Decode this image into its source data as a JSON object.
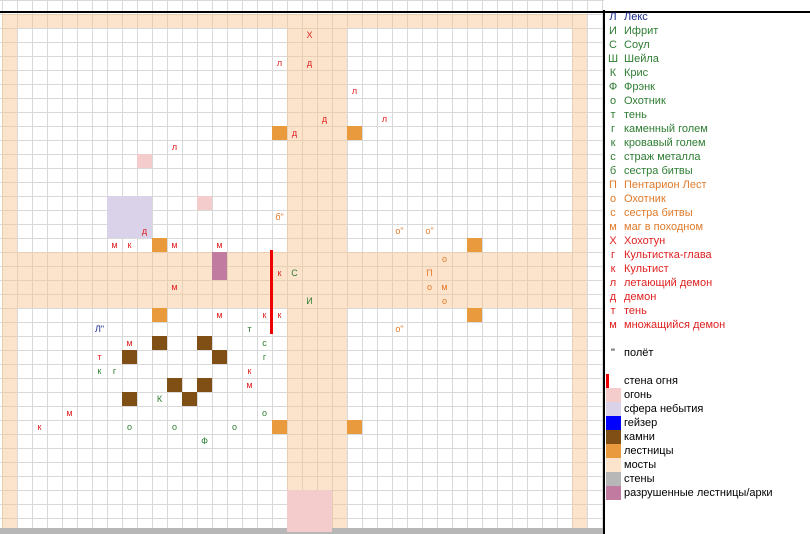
{
  "colors": {
    "bridge": "#fce4cc",
    "stairs": "#e89a3c",
    "fire": "#f4cccc",
    "void": "#d9d2e9",
    "geyser": "#0000ff",
    "rock": "#7f4f15",
    "wall": "#b7b7b7",
    "ruined": "#c27ba0",
    "firewall": "#ee0000",
    "blue": "#1a2a8a",
    "green": "#2e7d32",
    "orange": "#e07a2a",
    "red": "#e02020"
  },
  "legend": [
    {
      "sym": "Л",
      "text": "Лекс",
      "color": "blue",
      "kind": "ally"
    },
    {
      "sym": "И",
      "text": "Ифрит",
      "color": "green",
      "kind": "ally"
    },
    {
      "sym": "С",
      "text": "Соул",
      "color": "green",
      "kind": "ally"
    },
    {
      "sym": "Ш",
      "text": "Шейла",
      "color": "green",
      "kind": "ally"
    },
    {
      "sym": "К",
      "text": "Крис",
      "color": "green",
      "kind": "ally"
    },
    {
      "sym": "Ф",
      "text": "Фрэнк",
      "color": "green",
      "kind": "ally"
    },
    {
      "sym": "о",
      "text": "Охотник",
      "color": "green",
      "kind": "ally"
    },
    {
      "sym": "т",
      "text": "тень",
      "color": "green",
      "kind": "ally"
    },
    {
      "sym": "г",
      "text": "каменный голем",
      "color": "green",
      "kind": "ally"
    },
    {
      "sym": "к",
      "text": "кровавый голем",
      "color": "green",
      "kind": "ally"
    },
    {
      "sym": "с",
      "text": "страж металла",
      "color": "green",
      "kind": "ally"
    },
    {
      "sym": "б",
      "text": "сестра битвы",
      "color": "green",
      "kind": "ally"
    },
    {
      "sym": "П",
      "text": "Пентарион Лест",
      "color": "orange",
      "kind": "neutral"
    },
    {
      "sym": "о",
      "text": "Охотник",
      "color": "orange",
      "kind": "neutral"
    },
    {
      "sym": "с",
      "text": "сестра битвы",
      "color": "orange",
      "kind": "neutral"
    },
    {
      "sym": "м",
      "text": "маг в походном",
      "color": "orange",
      "kind": "neutral"
    },
    {
      "sym": "Х",
      "text": "Хохотун",
      "color": "red",
      "kind": "enemy"
    },
    {
      "sym": "г",
      "text": "Культистка-глава",
      "color": "red",
      "kind": "enemy"
    },
    {
      "sym": "к",
      "text": "Культист",
      "color": "red",
      "kind": "enemy"
    },
    {
      "sym": "л",
      "text": "летающий демон",
      "color": "red",
      "kind": "enemy"
    },
    {
      "sym": "д",
      "text": "демон",
      "color": "red",
      "kind": "enemy"
    },
    {
      "sym": "т",
      "text": "тень",
      "color": "red",
      "kind": "enemy"
    },
    {
      "sym": "м",
      "text": "множащийся демон",
      "color": "red",
      "kind": "enemy"
    },
    {
      "sym": "",
      "text": "",
      "kind": "gap"
    },
    {
      "sym": "\"",
      "text": "полёт",
      "color": "black",
      "kind": "note"
    },
    {
      "sym": "",
      "text": "",
      "kind": "gap"
    },
    {
      "sym": "",
      "text": "стена огня",
      "swatch": "firewall",
      "kind": "terrain"
    },
    {
      "sym": "",
      "text": "огонь",
      "swatch": "fire",
      "kind": "terrain"
    },
    {
      "sym": "",
      "text": "сфера небытия",
      "swatch": "void",
      "kind": "terrain"
    },
    {
      "sym": "",
      "text": "гейзер",
      "swatch": "geyser",
      "kind": "terrain"
    },
    {
      "sym": "",
      "text": "камни",
      "swatch": "rock",
      "kind": "terrain"
    },
    {
      "sym": "",
      "text": "лестницы",
      "swatch": "stairs",
      "kind": "terrain"
    },
    {
      "sym": "",
      "text": "мосты",
      "swatch": "bridge",
      "kind": "terrain"
    },
    {
      "sym": "",
      "text": "стены",
      "swatch": "wall",
      "kind": "terrain"
    },
    {
      "sym": "",
      "text": "разрушенные лестницы/арки",
      "swatch": "ruined",
      "kind": "terrain"
    }
  ],
  "terrain": [
    {
      "t": "stairs",
      "c": 18,
      "r": 9
    },
    {
      "t": "stairs",
      "c": 23,
      "r": 9
    },
    {
      "t": "stairs",
      "c": 10,
      "r": 17
    },
    {
      "t": "stairs",
      "c": 31,
      "r": 17
    },
    {
      "t": "stairs",
      "c": 10,
      "r": 22
    },
    {
      "t": "stairs",
      "c": 31,
      "r": 22
    },
    {
      "t": "stairs",
      "c": 18,
      "r": 30
    },
    {
      "t": "stairs",
      "c": 23,
      "r": 30
    },
    {
      "t": "fire",
      "c": 9,
      "r": 11
    },
    {
      "t": "fire",
      "c": 13,
      "r": 14
    },
    {
      "t": "void",
      "c": 7,
      "r": 14
    },
    {
      "t": "void",
      "c": 8,
      "r": 14
    },
    {
      "t": "void",
      "c": 9,
      "r": 14
    },
    {
      "t": "void",
      "c": 7,
      "r": 15
    },
    {
      "t": "void",
      "c": 8,
      "r": 15
    },
    {
      "t": "void",
      "c": 9,
      "r": 15
    },
    {
      "t": "void",
      "c": 7,
      "r": 16
    },
    {
      "t": "void",
      "c": 8,
      "r": 16
    },
    {
      "t": "void",
      "c": 9,
      "r": 16
    },
    {
      "t": "ruined",
      "c": 14,
      "r": 18
    },
    {
      "t": "ruined",
      "c": 14,
      "r": 19
    },
    {
      "t": "rock",
      "c": 10,
      "r": 24
    },
    {
      "t": "rock",
      "c": 13,
      "r": 24
    },
    {
      "t": "rock",
      "c": 8,
      "r": 25
    },
    {
      "t": "rock",
      "c": 14,
      "r": 25
    },
    {
      "t": "rock",
      "c": 11,
      "r": 27
    },
    {
      "t": "rock",
      "c": 13,
      "r": 27
    },
    {
      "t": "rock",
      "c": 8,
      "r": 28
    },
    {
      "t": "rock",
      "c": 12,
      "r": 28
    },
    {
      "t": "fire",
      "c": 19,
      "r": 35
    },
    {
      "t": "fire",
      "c": 20,
      "r": 35
    },
    {
      "t": "fire",
      "c": 21,
      "r": 35
    },
    {
      "t": "fire",
      "c": 19,
      "r": 36
    },
    {
      "t": "fire",
      "c": 20,
      "r": 36
    },
    {
      "t": "fire",
      "c": 21,
      "r": 36
    },
    {
      "t": "fire",
      "c": 19,
      "r": 37
    },
    {
      "t": "fire",
      "c": 20,
      "r": 37
    },
    {
      "t": "fire",
      "c": 21,
      "r": 37
    }
  ],
  "tokens": [
    {
      "s": "Х",
      "c": 20,
      "r": 2,
      "k": "red"
    },
    {
      "s": "л",
      "c": 18,
      "r": 4,
      "k": "red"
    },
    {
      "s": "д",
      "c": 20,
      "r": 4,
      "k": "red"
    },
    {
      "s": "л",
      "c": 23,
      "r": 6,
      "k": "red"
    },
    {
      "s": "д",
      "c": 21,
      "r": 8,
      "k": "red"
    },
    {
      "s": "л",
      "c": 25,
      "r": 8,
      "k": "red"
    },
    {
      "s": "д",
      "c": 19,
      "r": 9,
      "k": "red"
    },
    {
      "s": "л",
      "c": 11,
      "r": 10,
      "k": "red"
    },
    {
      "s": "б\"",
      "c": 18,
      "r": 15,
      "k": "orange"
    },
    {
      "s": "о\"",
      "c": 26,
      "r": 16,
      "k": "orange"
    },
    {
      "s": "о\"",
      "c": 28,
      "r": 16,
      "k": "orange"
    },
    {
      "s": "д",
      "c": 9,
      "r": 16,
      "k": "red"
    },
    {
      "s": "м",
      "c": 7,
      "r": 17,
      "k": "red"
    },
    {
      "s": "к",
      "c": 8,
      "r": 17,
      "k": "red"
    },
    {
      "s": "м",
      "c": 11,
      "r": 17,
      "k": "red"
    },
    {
      "s": "м",
      "c": 14,
      "r": 17,
      "k": "red"
    },
    {
      "s": "о",
      "c": 29,
      "r": 18,
      "k": "orange"
    },
    {
      "s": "к",
      "c": 18,
      "r": 19,
      "k": "red"
    },
    {
      "s": "С",
      "c": 19,
      "r": 19,
      "k": "green"
    },
    {
      "s": "П",
      "c": 28,
      "r": 19,
      "k": "orange"
    },
    {
      "s": "м",
      "c": 11,
      "r": 20,
      "k": "red"
    },
    {
      "s": "о",
      "c": 28,
      "r": 20,
      "k": "orange"
    },
    {
      "s": "м",
      "c": 29,
      "r": 20,
      "k": "orange"
    },
    {
      "s": "И",
      "c": 20,
      "r": 21,
      "k": "green"
    },
    {
      "s": "о",
      "c": 29,
      "r": 21,
      "k": "orange"
    },
    {
      "s": "м",
      "c": 14,
      "r": 22,
      "k": "red"
    },
    {
      "s": "к",
      "c": 17,
      "r": 22,
      "k": "red"
    },
    {
      "s": "к",
      "c": 18,
      "r": 22,
      "k": "red"
    },
    {
      "s": "Л\"",
      "c": 6,
      "r": 23,
      "k": "blue"
    },
    {
      "s": "т",
      "c": 16,
      "r": 23,
      "k": "green"
    },
    {
      "s": "о\"",
      "c": 26,
      "r": 23,
      "k": "orange"
    },
    {
      "s": "м",
      "c": 8,
      "r": 24,
      "k": "red"
    },
    {
      "s": "с",
      "c": 17,
      "r": 24,
      "k": "green"
    },
    {
      "s": "т",
      "c": 6,
      "r": 25,
      "k": "red"
    },
    {
      "s": "г",
      "c": 17,
      "r": 25,
      "k": "green"
    },
    {
      "s": "к",
      "c": 6,
      "r": 26,
      "k": "green"
    },
    {
      "s": "г",
      "c": 7,
      "r": 26,
      "k": "green"
    },
    {
      "s": "к",
      "c": 16,
      "r": 26,
      "k": "red"
    },
    {
      "s": "м",
      "c": 16,
      "r": 27,
      "k": "red"
    },
    {
      "s": "К",
      "c": 10,
      "r": 28,
      "k": "green"
    },
    {
      "s": "м",
      "c": 4,
      "r": 29,
      "k": "red"
    },
    {
      "s": "о",
      "c": 17,
      "r": 29,
      "k": "green"
    },
    {
      "s": "к",
      "c": 2,
      "r": 30,
      "k": "red"
    },
    {
      "s": "о",
      "c": 8,
      "r": 30,
      "k": "green"
    },
    {
      "s": "о",
      "c": 11,
      "r": 30,
      "k": "green"
    },
    {
      "s": "о",
      "c": 15,
      "r": 30,
      "k": "green"
    },
    {
      "s": "Ф",
      "c": 13,
      "r": 31,
      "k": "green"
    }
  ]
}
